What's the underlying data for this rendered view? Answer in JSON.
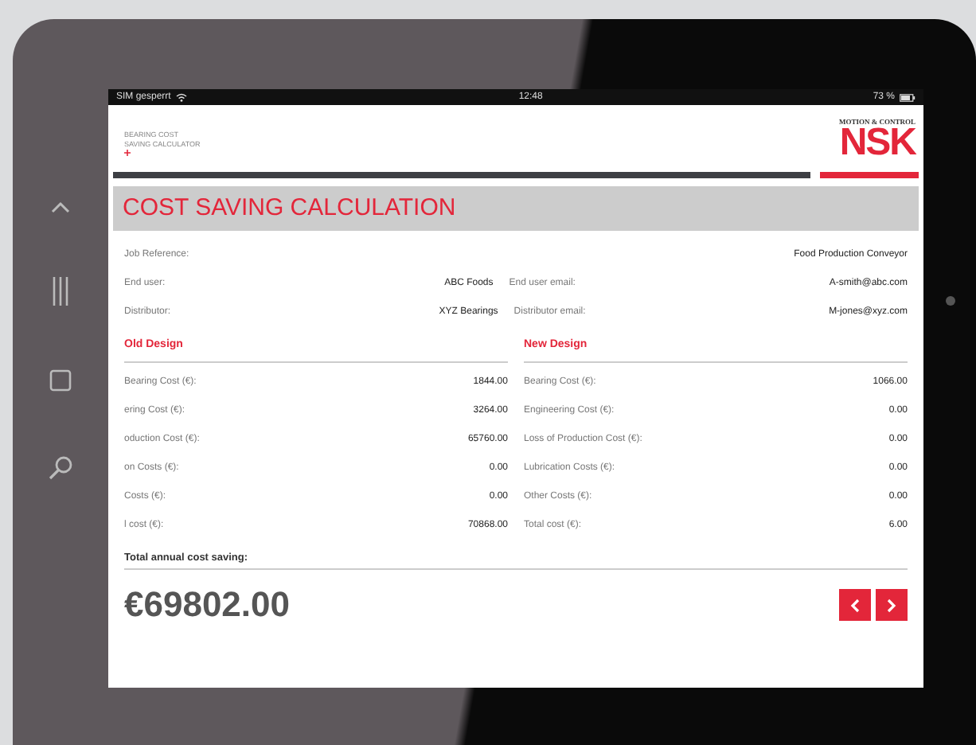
{
  "status_bar": {
    "carrier": "SIM gesperrt",
    "time": "12:48",
    "battery": "73 %"
  },
  "header": {
    "app_name": [
      "BEARING COST",
      "SAVING CALCULATOR"
    ],
    "logo_tagline": "MOTION & CONTROL",
    "logo": "NSK"
  },
  "title": "COST SAVING CALCULATION",
  "job": {
    "label": "Job Reference:",
    "value": "Food Production Conveyor"
  },
  "contacts": [
    {
      "label": "End user:",
      "value": "ABC Foods",
      "email_label": "End user email:",
      "email": "A-smith@abc.com"
    },
    {
      "label": "Distributor:",
      "value": "XYZ Bearings",
      "email_label": "Distributor email:",
      "email": "M-jones@xyz.com"
    }
  ],
  "designs": [
    {
      "heading": "Old Design",
      "rows": [
        {
          "label": "Bearing Cost (€):",
          "value": "1844.00"
        },
        {
          "label": "ering Cost (€):",
          "value": "3264.00"
        },
        {
          "label": "oduction Cost (€):",
          "value": "65760.00"
        },
        {
          "label": "on Costs (€):",
          "value": "0.00"
        },
        {
          "label": "Costs (€):",
          "value": "0.00"
        },
        {
          "label": "l cost (€):",
          "value": "70868.00"
        }
      ]
    },
    {
      "heading": "New Design",
      "rows": [
        {
          "label": "Bearing Cost (€):",
          "value": "1066.00"
        },
        {
          "label": "Engineering Cost (€):",
          "value": "0.00"
        },
        {
          "label": "Loss of Production Cost (€):",
          "value": "0.00"
        },
        {
          "label": "Lubrication Costs (€):",
          "value": "0.00"
        },
        {
          "label": "Other Costs (€):",
          "value": "0.00"
        },
        {
          "label": "Total cost (€):",
          "value": "6.00"
        }
      ]
    }
  ],
  "total": {
    "label": "Total annual cost saving:",
    "value": "€69802.00"
  }
}
